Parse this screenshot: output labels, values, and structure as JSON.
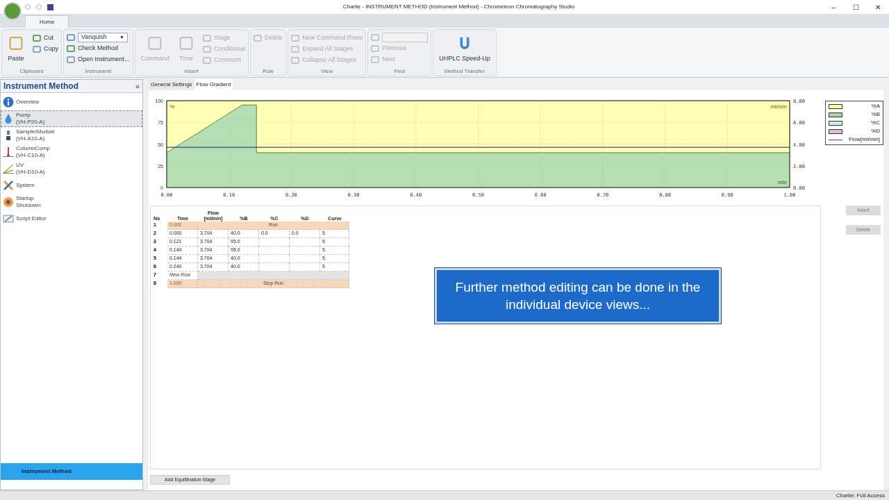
{
  "window": {
    "title": "Charlie - INSTRUMENT METHOD (Instrument Method) - Chromeleon Chromatography Studio",
    "controls": [
      "–",
      "☐",
      "✕"
    ]
  },
  "ribbon_tabs": [
    {
      "label": "Home",
      "selected": true
    }
  ],
  "ribbon_groups": [
    {
      "label": "Clipboard",
      "items": [
        {
          "kind": "large",
          "label": "Paste",
          "disabled": false
        },
        {
          "kind": "small",
          "label": "Cut",
          "disabled": false
        },
        {
          "kind": "small",
          "label": "Copy",
          "disabled": false
        }
      ]
    },
    {
      "label": "Instrument",
      "items": [
        {
          "kind": "dropdown",
          "label": "Vanquish",
          "arrow": "▼",
          "disabled": false
        },
        {
          "kind": "small",
          "label": "Check Method",
          "disabled": false
        },
        {
          "kind": "small",
          "label": "Open Instrument...",
          "disabled": false
        }
      ]
    },
    {
      "label": "Insert",
      "items": [
        {
          "kind": "large",
          "label": "Command",
          "disabled": true
        },
        {
          "kind": "large",
          "label": "Time",
          "disabled": true
        },
        {
          "kind": "small",
          "label": "Stage",
          "disabled": true
        },
        {
          "kind": "small",
          "label": "Conditional",
          "disabled": true
        },
        {
          "kind": "small",
          "label": "Comment",
          "disabled": true
        }
      ]
    },
    {
      "label": "Row",
      "items": [
        {
          "kind": "small",
          "label": "Delete",
          "disabled": true
        }
      ]
    },
    {
      "label": "View",
      "items": [
        {
          "kind": "small",
          "label": "New Command Rows",
          "disabled": true
        },
        {
          "kind": "small",
          "label": "Expand All Stages",
          "disabled": true
        },
        {
          "kind": "small",
          "label": "Collapse All Stages",
          "disabled": true
        }
      ]
    },
    {
      "label": "Find",
      "items": [
        {
          "kind": "search",
          "disabled": true
        },
        {
          "kind": "small",
          "label": "Previous",
          "disabled": true
        },
        {
          "kind": "small",
          "label": "Next",
          "disabled": true
        }
      ]
    },
    {
      "label": "Method Transfer",
      "items": [
        {
          "kind": "large",
          "label": "UHPLC Speed-Up",
          "disabled": false
        }
      ]
    }
  ],
  "sidebar": {
    "title": "Instrument Method",
    "collapse": "«",
    "items": [
      {
        "label": "Overview",
        "selected": false,
        "kind": "info"
      },
      {
        "label": "Pump",
        "sub": "(VH-P20-A)",
        "selected": true,
        "kind": "drop"
      },
      {
        "label": "SamplerModule",
        "sub": "(VH-A10-A)",
        "selected": false,
        "kind": "sampler"
      },
      {
        "label": "ColumnComp",
        "sub": "(VH-C10-A)",
        "selected": false,
        "kind": "thermo"
      },
      {
        "label": "UV",
        "sub": "(VH-D10-A)",
        "selected": false,
        "kind": "uv"
      },
      {
        "label": "System",
        "selected": false,
        "kind": "tools"
      },
      {
        "label": "Startup",
        "sub": "Shutdown",
        "selected": false,
        "kind": "startup"
      },
      {
        "label": "Script Editor",
        "selected": false,
        "kind": "script"
      }
    ],
    "bottom": {
      "label": "Instrument Method",
      "selected": true
    }
  },
  "tabs": [
    {
      "label": "General Settings",
      "selected": false
    },
    {
      "label": "Flow Gradient",
      "selected": true
    }
  ],
  "chart": {
    "legend_extra": [
      {
        "name": "%C",
        "color": "#c8f0f0"
      },
      {
        "name": "%D",
        "color": "#d8c0d8"
      }
    ],
    "unit_left": "%",
    "unit_right": "ml/min",
    "unit_x": "min",
    "chart_data": {
      "type": "area",
      "stacked": true,
      "x": [
        0,
        0.121,
        0.144,
        0.144,
        0.24,
        1.0
      ],
      "xlim": [
        0,
        1
      ],
      "ylim": [
        0,
        100
      ],
      "xticks": [
        {
          "value": 0,
          "label": "0.00"
        },
        {
          "value": 0.1,
          "label": "0.10"
        },
        {
          "value": 0.2,
          "label": "0.20"
        },
        {
          "value": 0.3,
          "label": "0.30"
        },
        {
          "value": 0.4,
          "label": "0.40"
        },
        {
          "value": 0.5,
          "label": "0.50"
        },
        {
          "value": 0.6,
          "label": "0.60"
        },
        {
          "value": 0.7,
          "label": "0.70"
        },
        {
          "value": 0.8,
          "label": "0.80"
        },
        {
          "value": 0.9,
          "label": "0.90"
        },
        {
          "value": 1,
          "label": "1.00"
        }
      ],
      "yticks": [
        0,
        25,
        50,
        75,
        100
      ],
      "y2ticks": [
        {
          "value": 0,
          "label": "0.00"
        },
        {
          "value": 2,
          "label": "2.00"
        },
        {
          "value": 4,
          "label": "4.00"
        },
        {
          "value": 6,
          "label": "6.00"
        },
        {
          "value": 8,
          "label": "8.00"
        }
      ],
      "y2lim": [
        0,
        8
      ],
      "series": [
        {
          "name": "%A",
          "color": "#ffffa8",
          "values": [
            60,
            5,
            5,
            60,
            60,
            60
          ]
        },
        {
          "name": "%B",
          "color": "#a8d8a8",
          "values": [
            40,
            95,
            95,
            40,
            40,
            40
          ]
        },
        {
          "name": "Flow[ml/min]",
          "color": "#404090",
          "axis": "y2",
          "type": "line",
          "values": [
            3.7,
            3.7,
            3.7,
            3.7,
            3.7,
            3.7
          ]
        }
      ]
    }
  },
  "table": {
    "columns": [
      "No",
      "Time",
      "Flow\n[ml/min]",
      "%B",
      "%C",
      "%D",
      "Curve"
    ],
    "rows": [
      {
        "kind": "event",
        "no": "1",
        "time": "0.000",
        "text": "Run"
      },
      {
        "kind": "step",
        "no": "2",
        "cells": [
          "0.000",
          "3.704",
          "40.0",
          "0.0",
          "0.0",
          "5"
        ]
      },
      {
        "kind": "step",
        "no": "3",
        "cells": [
          "0.121",
          "3.704",
          "95.0",
          "",
          "",
          "5"
        ]
      },
      {
        "kind": "step",
        "no": "4",
        "cells": [
          "0.144",
          "3.704",
          "95.0",
          "",
          "",
          "5"
        ]
      },
      {
        "kind": "step",
        "no": "5",
        "cells": [
          "0.144",
          "3.704",
          "40.0",
          "",
          "",
          "5"
        ]
      },
      {
        "kind": "step",
        "no": "6",
        "cells": [
          "0.240",
          "3.704",
          "40.0",
          "",
          "",
          "5"
        ]
      },
      {
        "kind": "new",
        "no": "7",
        "time": "New Row"
      },
      {
        "kind": "event",
        "no": "8",
        "time": "1.000",
        "text": "Stop Run"
      }
    ]
  },
  "side_buttons": [
    {
      "label": "Insert",
      "disabled": true
    },
    {
      "label": "Delete",
      "disabled": true
    }
  ],
  "callout": "Further method editing can be done in the individual device views...",
  "add_stage_button": "Add Equilibration Stage",
  "status_bar": "Charlie: Full Access"
}
